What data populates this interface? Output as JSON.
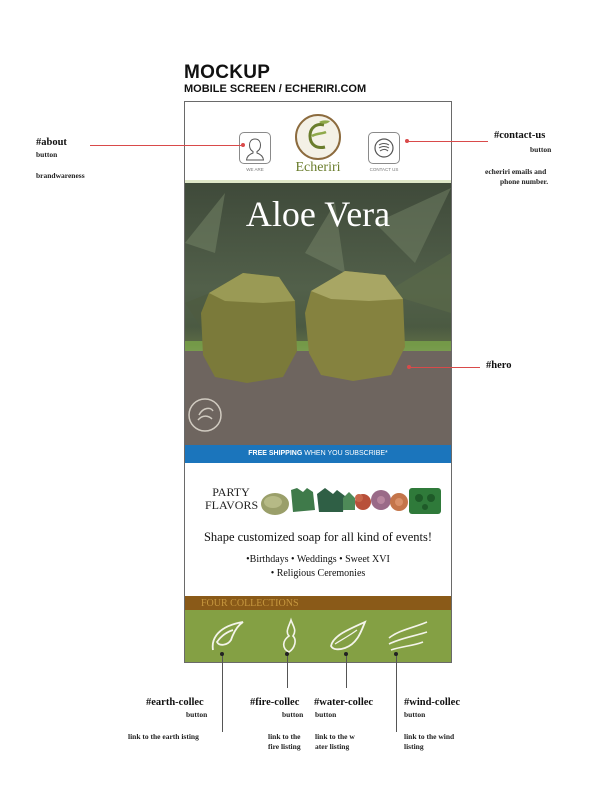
{
  "page": {
    "title": "MOCKUP",
    "subtitle": "MOBILE SCREEN / ECHERIRI.COM"
  },
  "header": {
    "about_caption": "WE ARE",
    "contact_caption": "CONTACT US",
    "logo_text": "Echeriri"
  },
  "hero": {
    "title": "Aloe Vera"
  },
  "shipping_bar": {
    "bold": "FREE SHIPPING",
    "rest": " WHEN YOU SUBSCRIBE*"
  },
  "party": {
    "label_line1": "PARTY",
    "label_line2": "FLAVORS",
    "tagline": "Shape customized soap for all kind of events!",
    "list_line1": "•Birthdays • Weddings • Sweet XVI",
    "list_line2": "• Religious Ceremonies"
  },
  "collections": {
    "label": "FOUR COLLECTIONS"
  },
  "annotations": {
    "about": {
      "id": "#about",
      "type": "button",
      "note": "brandwareness"
    },
    "contact": {
      "id": "#contact-us",
      "type": "button",
      "note_line1": "echeriri emails and",
      "note_line2": "phone number."
    },
    "hero": {
      "id": "#hero"
    },
    "earth": {
      "id": "#earth-collec",
      "type": "button",
      "note": "link to the earth isting"
    },
    "fire": {
      "id": "#fire-collec",
      "type": "button",
      "note_line1": "link to the",
      "note_line2": "fire listing"
    },
    "water": {
      "id": "#water-collec",
      "type": "button",
      "note_line1": "link to the w",
      "note_line2": "ater listing"
    },
    "wind": {
      "id": "#wind-collec",
      "type": "button",
      "note_line1": "link to the wind",
      "note_line2": "listing"
    }
  },
  "colors": {
    "brand_green": "#84a044",
    "brand_brown": "#8a5a18",
    "ship_blue": "#1b75bc",
    "annotation_red": "#d94a4a"
  }
}
